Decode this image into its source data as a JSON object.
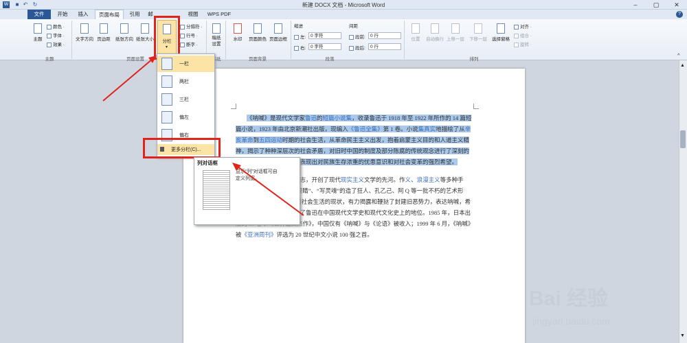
{
  "window": {
    "title": "新建 DOCX 文档 - Microsoft Word",
    "controls": [
      "–",
      "▢",
      "✕"
    ]
  },
  "tabs": [
    "文件",
    "开始",
    "插入",
    "页面布局",
    "引用",
    "邮",
    "视图",
    "WPS PDF"
  ],
  "ribbon": {
    "theme": {
      "big": "主题",
      "small": [
        "颜色 ·",
        "字体 ·",
        "效果 ·"
      ],
      "group": "主题"
    },
    "page_setup": {
      "buttons": [
        "文字方向",
        "页边距",
        "纸张方向",
        "纸张大小",
        "分栏"
      ],
      "small": [
        "分隔符 ·",
        "行号 ·",
        "断字 ·"
      ],
      "group": "页面设置"
    },
    "draft": {
      "label": "稿纸\n设置",
      "group": "稿纸"
    },
    "page_bg": {
      "buttons": [
        "水印",
        "页面颜色",
        "页面边框"
      ],
      "group": "页面背景"
    },
    "paragraph": {
      "indent_title": "缩进",
      "spacing_title": "间距",
      "left_label": "左:",
      "left_value": "0 字符",
      "right_label": "右:",
      "right_value": "0 字符",
      "before_label": "段前:",
      "before_value": "0 行",
      "after_label": "段后:",
      "after_value": "0 行",
      "group": "段落"
    },
    "arrange": {
      "buttons": [
        "位置",
        "自动换行",
        "上移一层",
        "下移一层",
        "选择窗格"
      ],
      "small": [
        "对齐 ·",
        "组合 ·",
        "旋转 ·"
      ],
      "group": "排列"
    }
  },
  "dropdown": {
    "items": [
      "一栏",
      "两栏",
      "三栏",
      "偏左",
      "偏右"
    ],
    "more": "更多分栏(C)..."
  },
  "tooltip": {
    "title": "列对话框",
    "desc": "显示“列”对话框可自定义列宽。"
  },
  "document": {
    "p1": [
      {
        "t": "《呐喊》是现代文学家",
        "c": "sel"
      },
      {
        "t": "鲁迅",
        "c": "sel link"
      },
      {
        "t": "的",
        "c": "sel"
      },
      {
        "t": "短篇小说集",
        "c": "sel link"
      },
      {
        "t": "，收录鲁迅于 1918 年至 1922 年所作的 14 篇短篇小说，1923 年由北京新潮社出版，现编入",
        "c": "sel"
      },
      {
        "t": "《鲁迅全集》",
        "c": "sel link"
      },
      {
        "t": "第 1 卷。小说",
        "c": "sel"
      },
      {
        "t": "集真实",
        "c": "sel link"
      },
      {
        "t": "地描绘了从",
        "c": "sel"
      },
      {
        "t": "辛亥革命",
        "c": "sel link"
      },
      {
        "t": "到",
        "c": "sel"
      },
      {
        "t": "五四运动",
        "c": "sel link"
      },
      {
        "t": "时期的社会生活，从革命民主主义出发，抱着启蒙主义目的和人道主义精神，揭示了种种深层次的社会矛盾，对旧时中国的制度及部分陈腐的传统观念进行了深刻的剖析和比较彻底的否定，表现出对民族生存浓重的忧患意识和对社会变革的强烈希望。",
        "c": "sel"
      }
    ],
    "p2": [
      {
        "t": "代小说的开端与成熟的标志，开创了现代",
        "c": ""
      },
      {
        "t": "现实主义",
        "c": "link"
      },
      {
        "t": "文学的先河。作",
        "c": ""
      },
      {
        "t": "义",
        "c": "link"
      },
      {
        "t": "、",
        "c": ""
      },
      {
        "t": "浪漫主义",
        "c": "link"
      },
      {
        "t": "等多种手法，以传神的笔触和“画眼睛”、“写灵魂”的",
        "c": ""
      },
      {
        "t": "造了狂人、孔乙己、阿 Q 等一批不朽的艺术形象，深刻反映了 19",
        "c": ""
      },
      {
        "t": "时中国社会生活的现状，有力揭露和鞭挞了封建旧恶势力，表达",
        "c": ""
      },
      {
        "t": "呐喊，希望唤醒国民的思想，奠定了鲁迅在中国现代文学史和现代",
        "c": ""
      },
      {
        "t": "文化史上的地位。",
        "c": ""
      },
      {
        "t": "1985 年，日本出版的 50 卷本《世界最高杰作》，中国仅有《呐喊》与《论语》被收入",
        "c": ""
      },
      {
        "t": "；1999 年 6 月，《呐喊》被",
        "c": ""
      },
      {
        "t": "《亚洲周刊》",
        "c": "link"
      },
      {
        "t": "评选为 20 世纪中文小说 100 强之首。",
        "c": ""
      }
    ]
  },
  "watermark": {
    "logo": "Bai 经验",
    "url": "jingyan.baidu.com"
  },
  "colors": {
    "accent": "#2b5797",
    "highlight": "#e1241b",
    "selection": "#a9c8ec"
  }
}
